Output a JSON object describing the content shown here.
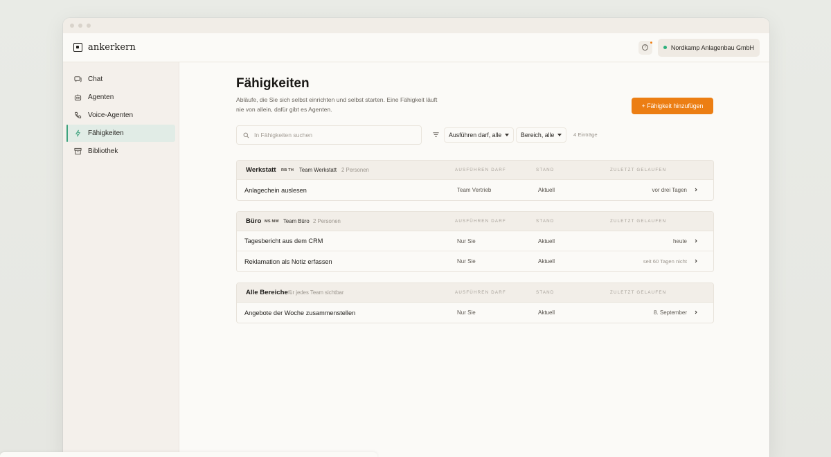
{
  "app": {
    "name": "ankerkern"
  },
  "header": {
    "org_name": "Nordkamp Anlagenbau GmbH",
    "help_icon": "question-circle-icon"
  },
  "sidebar": {
    "items": [
      {
        "label": "Chat",
        "icon": "chat-icon"
      },
      {
        "label": "Agenten",
        "icon": "robot-icon"
      },
      {
        "label": "Voice-Agenten",
        "icon": "phone-icon"
      },
      {
        "label": "Fähigkeiten",
        "icon": "bolt-icon",
        "active": true
      },
      {
        "label": "Bibliothek",
        "icon": "archive-icon"
      }
    ]
  },
  "page": {
    "title": "Fähigkeiten",
    "description": "Abläufe, die Sie sich selbst einrichten und selbst starten. Eine Fähigkeit läuft nie von allein, dafür gibt es Agenten.",
    "add_button": "+ Fähigkeit hinzufügen",
    "search_placeholder": "In Fähigkeiten suchen",
    "filter_run": "Ausführen darf, alle",
    "filter_area": "Bereich, alle",
    "count": "4 Einträge"
  },
  "columns": {
    "run": "AUSFÜHREN DARF",
    "state": "STAND",
    "last": "ZULETZT GELAUFEN"
  },
  "groups": [
    {
      "name": "Werkstatt",
      "avatars": "RB TH",
      "team": "Team Werkstatt",
      "persons": "2 Personen",
      "rows": [
        {
          "name": "Anlagechein auslesen",
          "who": "Team Vertrieb",
          "state": "Aktuell",
          "last": "vor drei Tagen"
        }
      ]
    },
    {
      "name": "Büro",
      "avatars": "MS MW",
      "team": "Team Büro",
      "persons": "2 Personen",
      "rows": [
        {
          "name": "Tagesbericht aus dem CRM",
          "who": "Nur Sie",
          "state": "Aktuell",
          "last": "heute"
        },
        {
          "name": "Reklamation als Notiz erfassen",
          "who": "Nur Sie",
          "state": "Aktuell",
          "last": "seit 60 Tagen nicht"
        }
      ]
    },
    {
      "name": "Alle Bereiche",
      "subtitle": "für jedes Team sichtbar",
      "rows": [
        {
          "name": "Angebote der Woche zusammenstellen",
          "who": "Nur Sie",
          "state": "Aktuell",
          "last": "8. September"
        }
      ]
    }
  ],
  "colors": {
    "accent": "#ec7e13",
    "active_nav": "#e1ece6",
    "status_dot": "#2bb07b"
  }
}
